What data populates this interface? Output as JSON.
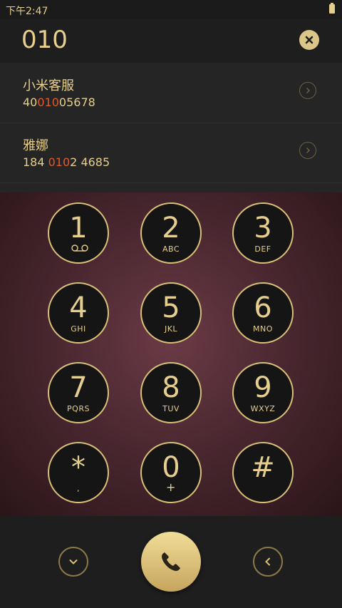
{
  "status_bar": {
    "time": "下午2:47",
    "battery_icon": "battery-icon"
  },
  "dial_input": {
    "number": "010",
    "clear_icon": "clear-icon"
  },
  "search_results": [
    {
      "name": "小米客服",
      "phone_pre": "40",
      "phone_match": "010",
      "phone_post": "05678",
      "arrow_icon": "chevron-right-icon"
    },
    {
      "name": "雅娜",
      "phone_pre": "184 ",
      "phone_match": "010",
      "phone_post": "2 4685",
      "arrow_icon": "chevron-right-icon"
    }
  ],
  "keypad": [
    {
      "digit": "1",
      "letters": ""
    },
    {
      "digit": "2",
      "letters": "ABC"
    },
    {
      "digit": "3",
      "letters": "DEF"
    },
    {
      "digit": "4",
      "letters": "GHI"
    },
    {
      "digit": "5",
      "letters": "JKL"
    },
    {
      "digit": "6",
      "letters": "MNO"
    },
    {
      "digit": "7",
      "letters": "PQRS"
    },
    {
      "digit": "8",
      "letters": "TUV"
    },
    {
      "digit": "9",
      "letters": "WXYZ"
    },
    {
      "digit": "*",
      "letters": ","
    },
    {
      "digit": "0",
      "letters": "+"
    },
    {
      "digit": "#",
      "letters": ""
    }
  ],
  "bottom_bar": {
    "collapse_icon": "chevron-down-icon",
    "call_icon": "phone-icon",
    "back_icon": "chevron-left-icon"
  },
  "colors": {
    "accent_gold": "#e6cf8e",
    "match_highlight": "#e25a2a",
    "keypad_background": "#4b2831"
  }
}
